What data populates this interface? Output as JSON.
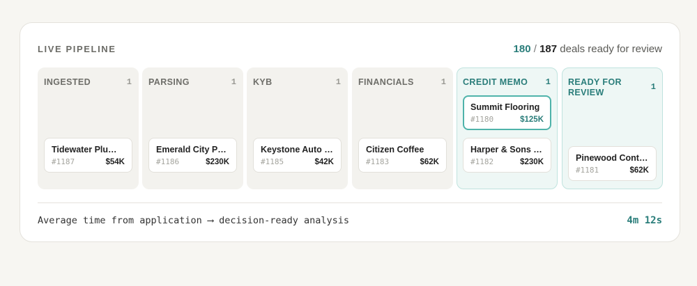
{
  "header": {
    "title": "LIVE PIPELINE",
    "ready_count": "180",
    "separator": "/",
    "total_count": "187",
    "suffix": "deals ready for review"
  },
  "columns": [
    {
      "name": "INGESTED",
      "count": "1",
      "deals": [
        {
          "name": "Tidewater Plu…",
          "id": "#1187",
          "amount": "$54K"
        }
      ]
    },
    {
      "name": "PARSING",
      "count": "1",
      "deals": [
        {
          "name": "Emerald City P…",
          "id": "#1186",
          "amount": "$230K"
        }
      ]
    },
    {
      "name": "KYB",
      "count": "1",
      "deals": [
        {
          "name": "Keystone Auto …",
          "id": "#1185",
          "amount": "$42K"
        }
      ]
    },
    {
      "name": "FINANCIALS",
      "count": "1",
      "deals": [
        {
          "name": "Citizen Coffee",
          "id": "#1183",
          "amount": "$62K"
        }
      ]
    },
    {
      "name": "CREDIT MEMO",
      "count": "1",
      "deals": [
        {
          "name": "Summit Flooring",
          "id": "#1180",
          "amount": "$125K"
        },
        {
          "name": "Harper & Sons …",
          "id": "#1182",
          "amount": "$230K"
        }
      ]
    },
    {
      "name": "READY FOR REVIEW",
      "count": "1",
      "deals": [
        {
          "name": "Pinewood Cont…",
          "id": "#1181",
          "amount": "$62K"
        }
      ]
    }
  ],
  "footer": {
    "text": "Average time from application ⟶ decision-ready analysis",
    "time": "4m 12s"
  },
  "colors": {
    "accent": "#2a7d7a",
    "accent_border": "#4fb3aa",
    "column_bg": "#f3f2ee",
    "teal_column_bg": "#eef7f5"
  }
}
